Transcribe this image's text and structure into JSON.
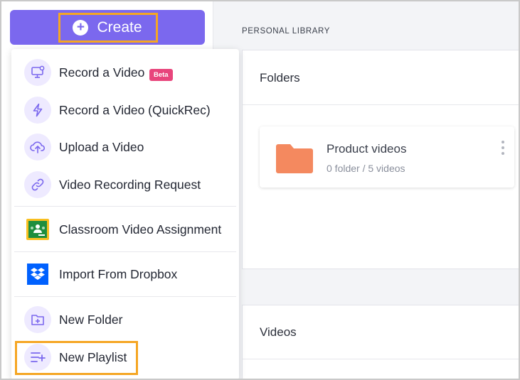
{
  "header": {
    "create_label": "Create",
    "library_title": "PERSONAL LIBRARY"
  },
  "create_menu": {
    "items": [
      {
        "label": "Record a Video",
        "icon": "monitor-record-icon",
        "badge": "Beta"
      },
      {
        "label": "Record a Video (QuickRec)",
        "icon": "lightning-bolt-icon"
      },
      {
        "label": "Upload a Video",
        "icon": "cloud-upload-icon"
      },
      {
        "label": "Video Recording Request",
        "icon": "link-icon"
      },
      {
        "label": "Classroom Video Assignment",
        "icon": "google-classroom-icon"
      },
      {
        "label": "Import From Dropbox",
        "icon": "dropbox-icon"
      },
      {
        "label": "New Folder",
        "icon": "folder-plus-icon"
      },
      {
        "label": "New Playlist",
        "icon": "playlist-add-icon"
      }
    ]
  },
  "folders_section": {
    "title": "Folders",
    "cards": [
      {
        "name": "Product videos",
        "meta": "0 folder / 5 videos"
      }
    ]
  },
  "videos_section": {
    "title": "Videos"
  },
  "colors": {
    "accent": "#7b68ee",
    "highlight": "#f5a623",
    "beta_badge": "#e8457c",
    "folder": "#f4895f"
  }
}
